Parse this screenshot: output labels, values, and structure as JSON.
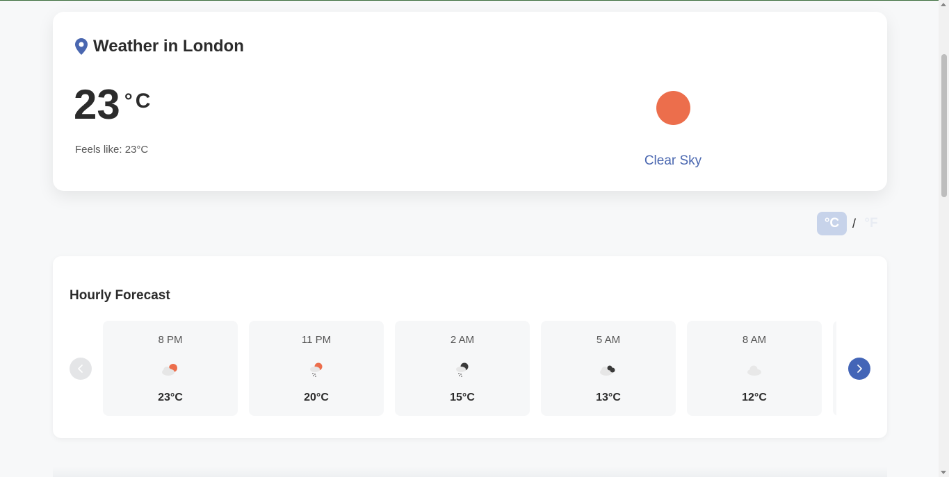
{
  "current": {
    "title": "Weather in London",
    "temperature": "23",
    "unit": "°C",
    "feels_like": "Feels like: 23°C",
    "condition": "Clear Sky",
    "condition_icon": "sun-icon"
  },
  "unit_toggle": {
    "celsius": "°C",
    "separator": "/",
    "fahrenheit": "°F",
    "selected": "°C"
  },
  "hourly": {
    "title": "Hourly Forecast",
    "items": [
      {
        "time": "8 PM",
        "temp": "23°C",
        "icon": "partly-cloudy-icon"
      },
      {
        "time": "11 PM",
        "temp": "20°C",
        "icon": "sun-rain-icon"
      },
      {
        "time": "2 AM",
        "temp": "15°C",
        "icon": "moon-rain-icon"
      },
      {
        "time": "5 AM",
        "temp": "13°C",
        "icon": "cloudy-night-icon"
      },
      {
        "time": "8 AM",
        "temp": "12°C",
        "icon": "cloud-icon"
      }
    ]
  },
  "colors": {
    "accent": "#4365b7",
    "sun": "#ec6e4c",
    "condition_text": "#4a67b0"
  }
}
